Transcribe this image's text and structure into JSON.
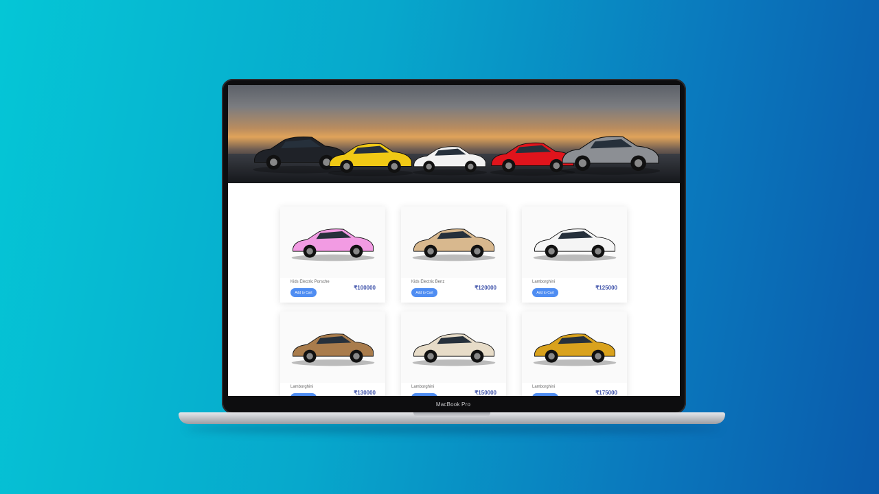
{
  "device": {
    "model_label": "MacBook Pro"
  },
  "hero": {
    "cars": [
      {
        "icon": "black-sedan-icon",
        "color": "#1f2228"
      },
      {
        "icon": "yellow-sports-car-icon",
        "color": "#f0c915"
      },
      {
        "icon": "white-supercar-icon",
        "color": "#f2f2f2"
      },
      {
        "icon": "red-sports-car-icon",
        "color": "#e0141c"
      },
      {
        "icon": "grey-coupe-icon",
        "color": "#8c8f94"
      }
    ]
  },
  "products": [
    {
      "name": "Kids Electric Porsche",
      "price": "₹100000",
      "button": "Add to Cart",
      "color": "#f29be3",
      "icon": "pink-toy-car-icon"
    },
    {
      "name": "Kids Electric Benz",
      "price": "₹120000",
      "button": "Add to Cart",
      "color": "#d8b88e",
      "icon": "gold-toy-car-icon"
    },
    {
      "name": "Lamborghini",
      "price": "₹125000",
      "button": "Add to Cart",
      "color": "#f5f5f5",
      "icon": "white-toy-car-icon"
    },
    {
      "name": "Lamborghini",
      "price": "₹130000",
      "button": "Add to Cart",
      "color": "#a97c4c",
      "icon": "bronze-toy-car-icon"
    },
    {
      "name": "Lamborghini",
      "price": "₹150000",
      "button": "Add to Cart",
      "color": "#e7dcc8",
      "icon": "champagne-toy-car-icon"
    },
    {
      "name": "Lamborghini",
      "price": "₹175000",
      "button": "Add to Cart",
      "color": "#d9a21d",
      "icon": "yellow-toy-car-icon"
    }
  ]
}
